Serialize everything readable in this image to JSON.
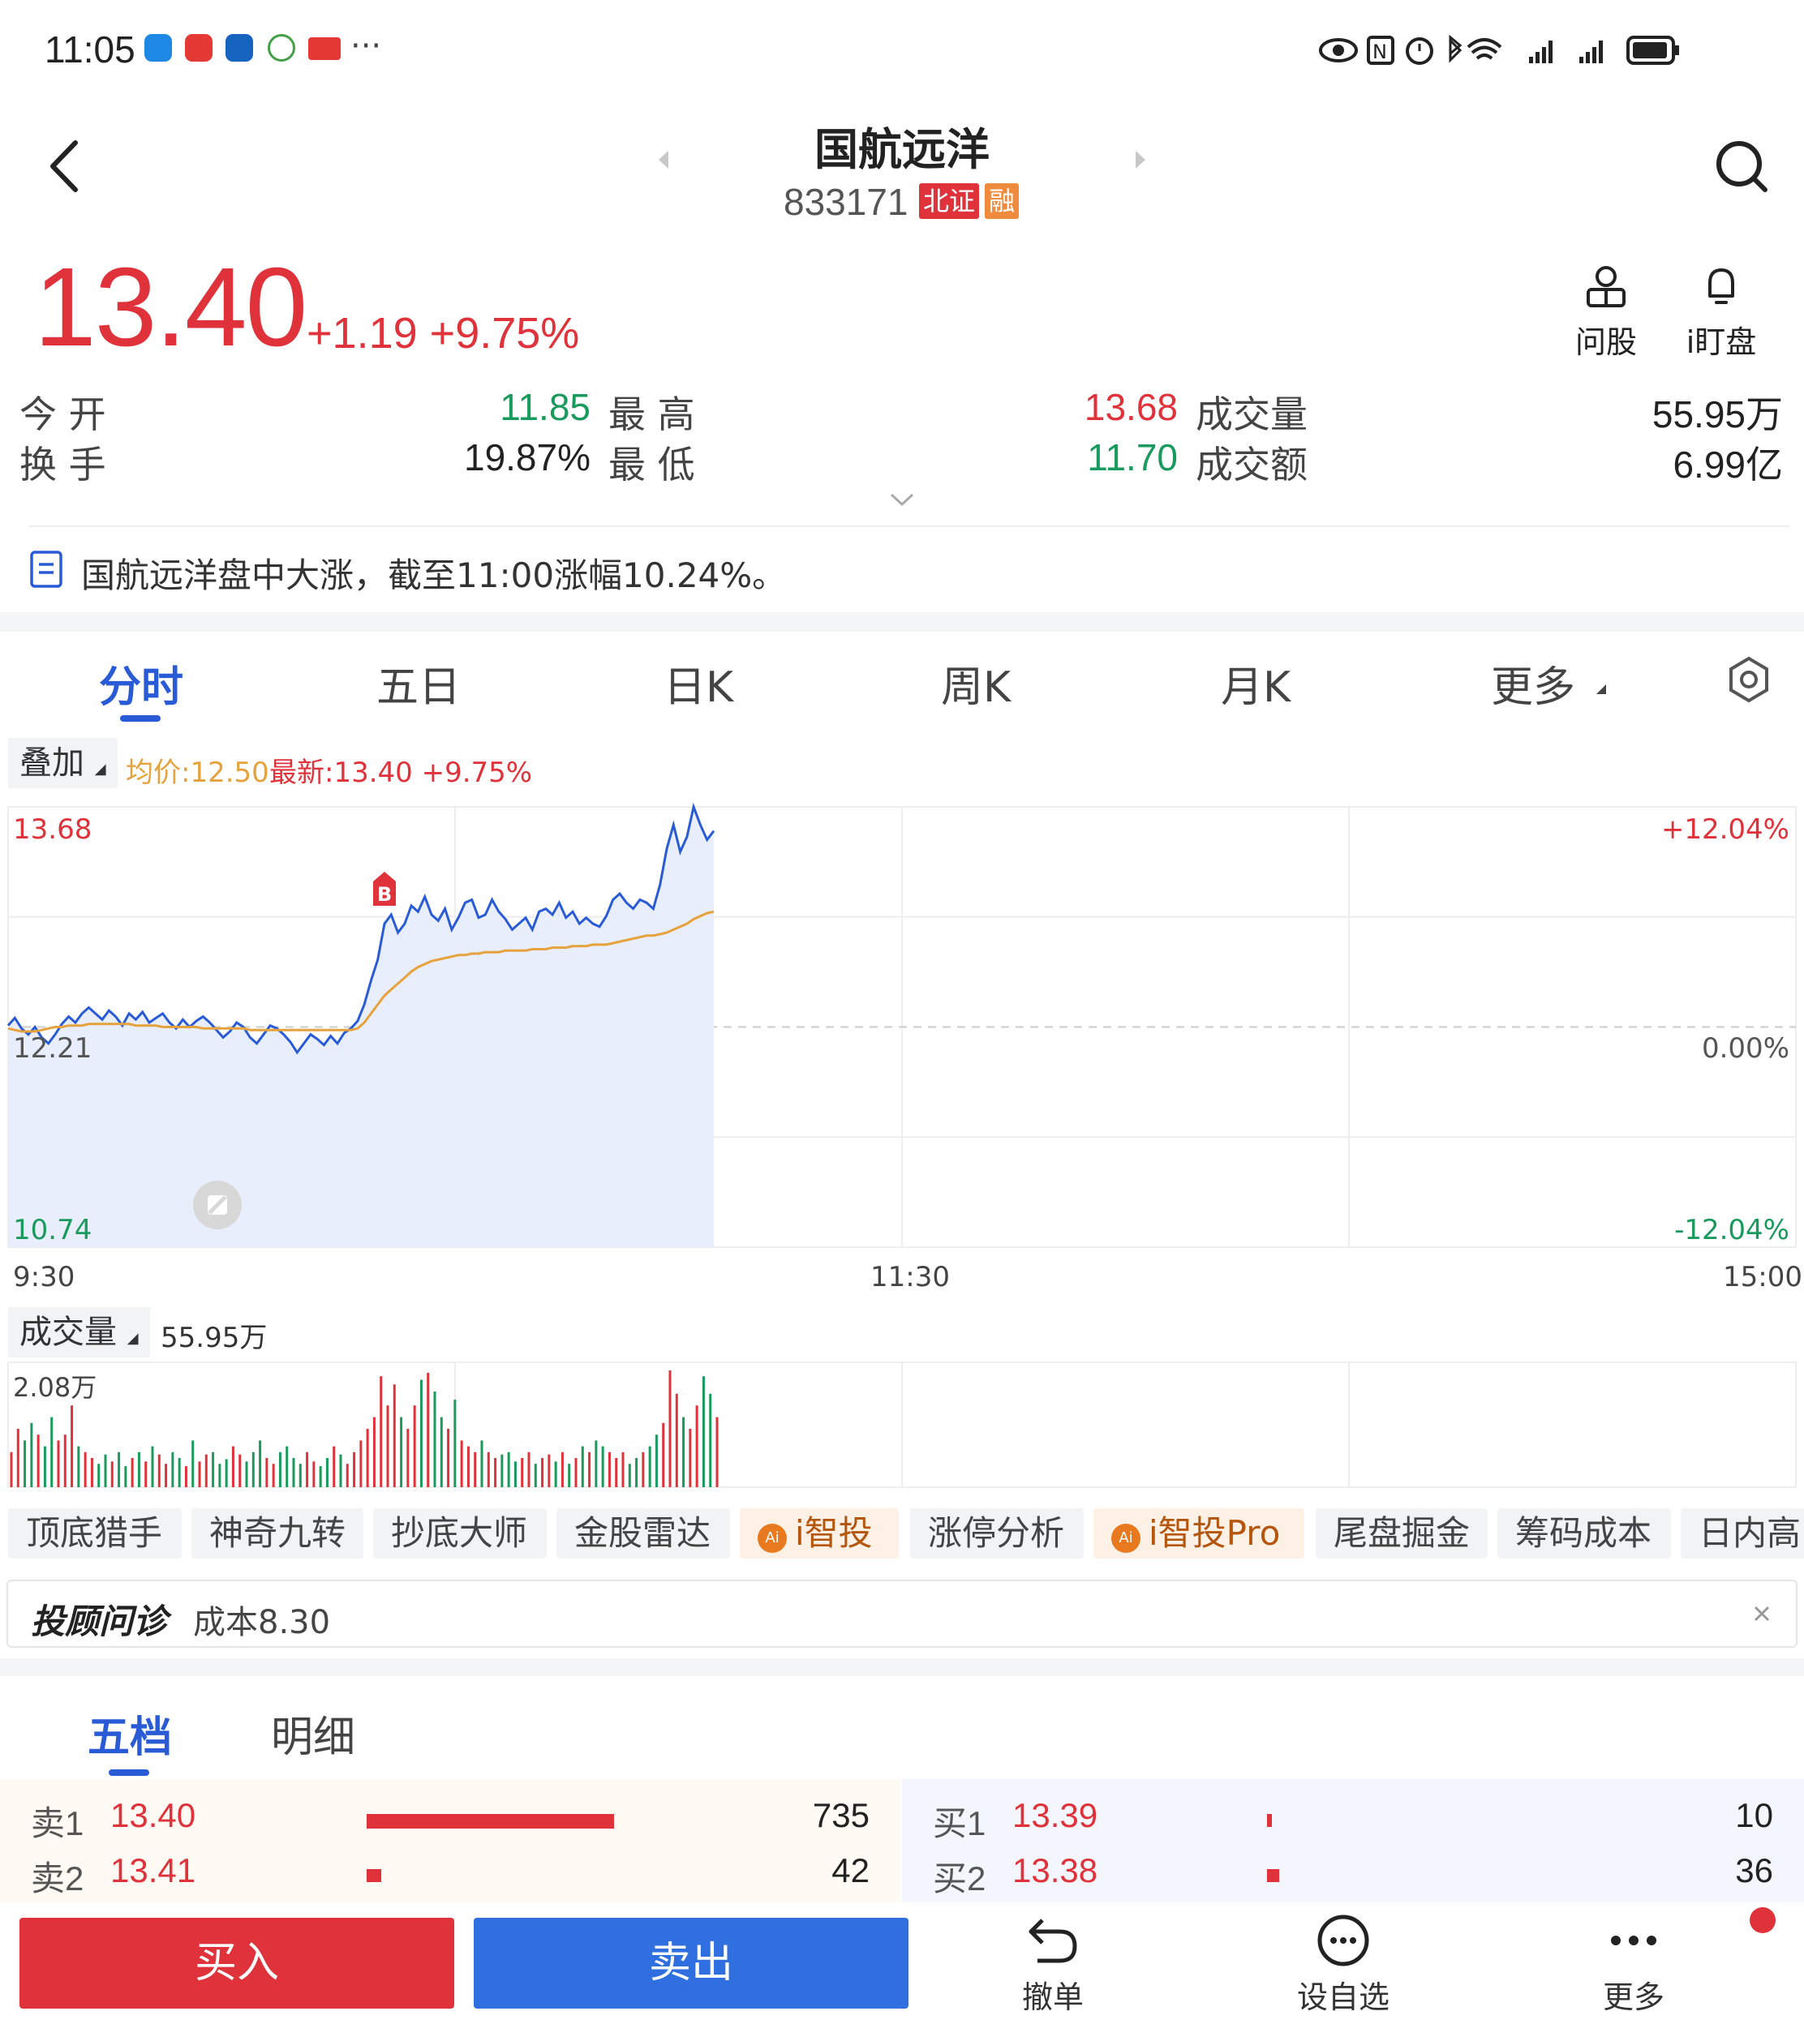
{
  "status": {
    "time": "11:05",
    "more": "···"
  },
  "header": {
    "title": "国航远洋",
    "code": "833171",
    "badge_exchange": "北证",
    "badge_margin": "融"
  },
  "quote": {
    "price": "13.40",
    "change": "+1.19",
    "change_pct": "+9.75%",
    "ask_label": "问股",
    "watch_label": "i盯盘"
  },
  "stats": {
    "open_label": "今 开",
    "open": "11.85",
    "high_label": "最 高",
    "high": "13.68",
    "volume_label": "成交量",
    "volume": "55.95万",
    "turnover_label": "换 手",
    "turnover": "19.87%",
    "low_label": "最 低",
    "low": "11.70",
    "amount_label": "成交额",
    "amount": "6.99亿"
  },
  "news": {
    "text": "国航远洋盘中大涨，截至11:00涨幅10.24%。"
  },
  "tabs": [
    "分时",
    "五日",
    "日K",
    "周K",
    "月K",
    "更多"
  ],
  "overlay": {
    "label": "叠加",
    "avg": "均价:12.50",
    "latest": "最新:13.40 +9.75%"
  },
  "chart_data": {
    "type": "line",
    "title": "",
    "x_ticks": [
      "9:30",
      "11:30",
      "15:00"
    ],
    "y_left": [
      "13.68",
      "12.21",
      "10.74"
    ],
    "y_right": [
      "+12.04%",
      "0.00%",
      "-12.04%"
    ],
    "ylim": [
      10.74,
      13.68
    ],
    "prev_close": 12.21,
    "marker": "B",
    "series": [
      {
        "name": "",
        "values": [
          12.22,
          12.27,
          12.2,
          12.16,
          12.21,
          12.14,
          12.1,
          12.16,
          12.23,
          12.28,
          12.24,
          12.3,
          12.34,
          12.3,
          12.26,
          12.32,
          12.28,
          12.22,
          12.3,
          12.26,
          12.31,
          12.24,
          12.27,
          12.3,
          12.24,
          12.2,
          12.26,
          12.21,
          12.25,
          12.28,
          12.24,
          12.19,
          12.14,
          12.18,
          12.24,
          12.21,
          12.14,
          12.1,
          12.16,
          12.22,
          12.2,
          12.16,
          12.11,
          12.04,
          12.1,
          12.16,
          12.13,
          12.09,
          12.15,
          12.1,
          12.17,
          12.2,
          12.25,
          12.36,
          12.52,
          12.66,
          12.9,
          12.96,
          12.84,
          12.9,
          13.02,
          12.98,
          13.08,
          12.96,
          12.92,
          13.0,
          12.86,
          12.94,
          13.04,
          13.06,
          12.94,
          12.96,
          13.06,
          12.98,
          12.93,
          12.86,
          12.9,
          12.94,
          12.86,
          12.98,
          13.0,
          12.96,
          13.04,
          12.94,
          12.98,
          12.9,
          12.94,
          12.9,
          12.88,
          12.95,
          13.06,
          13.1,
          13.04,
          13.0,
          13.06,
          13.04,
          13.0,
          13.16,
          13.4,
          13.56,
          13.38,
          13.48,
          13.68,
          13.56,
          13.46,
          13.52
        ]
      },
      {
        "name": "均价",
        "values": [
          12.2,
          12.19,
          12.18,
          12.18,
          12.18,
          12.19,
          12.2,
          12.21,
          12.21,
          12.22,
          12.22,
          12.22,
          12.23,
          12.23,
          12.23,
          12.23,
          12.23,
          12.23,
          12.23,
          12.22,
          12.22,
          12.22,
          12.22,
          12.21,
          12.21,
          12.21,
          12.21,
          12.21,
          12.21,
          12.2,
          12.2,
          12.2,
          12.2,
          12.2,
          12.2,
          12.2,
          12.19,
          12.19,
          12.19,
          12.19,
          12.19,
          12.19,
          12.19,
          12.19,
          12.19,
          12.19,
          12.19,
          12.19,
          12.19,
          12.19,
          12.19,
          12.19,
          12.2,
          12.24,
          12.3,
          12.36,
          12.42,
          12.46,
          12.5,
          12.54,
          12.58,
          12.61,
          12.63,
          12.65,
          12.66,
          12.67,
          12.68,
          12.69,
          12.69,
          12.7,
          12.7,
          12.71,
          12.71,
          12.71,
          12.72,
          12.72,
          12.72,
          12.72,
          12.73,
          12.73,
          12.73,
          12.74,
          12.74,
          12.74,
          12.75,
          12.75,
          12.75,
          12.76,
          12.76,
          12.76,
          12.77,
          12.78,
          12.79,
          12.8,
          12.81,
          12.82,
          12.82,
          12.83,
          12.84,
          12.86,
          12.88,
          12.9,
          12.93,
          12.95,
          12.97,
          12.98
        ]
      }
    ]
  },
  "volume": {
    "label": "成交量",
    "total": "55.95万",
    "max": "2.08万",
    "bars": [
      0.3,
      0.5,
      0.4,
      0.55,
      0.45,
      0.35,
      0.6,
      0.4,
      0.45,
      0.7,
      0.35,
      0.3,
      0.25,
      0.2,
      0.28,
      0.22,
      0.3,
      0.18,
      0.25,
      0.3,
      0.22,
      0.35,
      0.28,
      0.2,
      0.3,
      0.25,
      0.18,
      0.4,
      0.22,
      0.28,
      0.3,
      0.2,
      0.24,
      0.35,
      0.28,
      0.22,
      0.3,
      0.4,
      0.25,
      0.2,
      0.3,
      0.35,
      0.25,
      0.2,
      0.3,
      0.22,
      0.18,
      0.25,
      0.35,
      0.28,
      0.2,
      0.3,
      0.4,
      0.5,
      0.6,
      0.95,
      0.7,
      0.88,
      0.6,
      0.5,
      0.7,
      0.92,
      0.98,
      0.82,
      0.6,
      0.5,
      0.75,
      0.4,
      0.35,
      0.3,
      0.4,
      0.3,
      0.25,
      0.28,
      0.3,
      0.22,
      0.25,
      0.3,
      0.2,
      0.25,
      0.28,
      0.22,
      0.3,
      0.2,
      0.25,
      0.35,
      0.3,
      0.4,
      0.35,
      0.3,
      0.25,
      0.3,
      0.2,
      0.25,
      0.3,
      0.35,
      0.45,
      0.55,
      1.0,
      0.8,
      0.6,
      0.5,
      0.7,
      0.95,
      0.8,
      0.6
    ]
  },
  "tools": [
    "顶底猎手",
    "神奇九转",
    "抄底大师",
    "金股雷达",
    "i智投",
    "涨停分析",
    "i智投Pro",
    "尾盘掘金",
    "筹码成本",
    "日内高"
  ],
  "advisor": {
    "title": "投顾问诊",
    "text": "成本8.30"
  },
  "orderbook": {
    "tab_five": "五档",
    "tab_detail": "明细",
    "sell": [
      {
        "label": "卖1",
        "price": "13.40",
        "qty": "735",
        "ratio": 1.0
      },
      {
        "label": "卖2",
        "price": "13.41",
        "qty": "42",
        "ratio": 0.06
      }
    ],
    "buy": [
      {
        "label": "买1",
        "price": "13.39",
        "qty": "10",
        "ratio": 0.02
      },
      {
        "label": "买2",
        "price": "13.38",
        "qty": "36",
        "ratio": 0.05
      }
    ]
  },
  "bottom": {
    "buy": "买入",
    "sell": "卖出",
    "cancel": "撤单",
    "watchlist": "设自选",
    "more": "更多"
  },
  "colors": {
    "up": "#e0323a",
    "down": "#1a9a5c",
    "accent": "#2a5bd7",
    "avg": "#e6a23c",
    "line": "#2a5bd7"
  }
}
